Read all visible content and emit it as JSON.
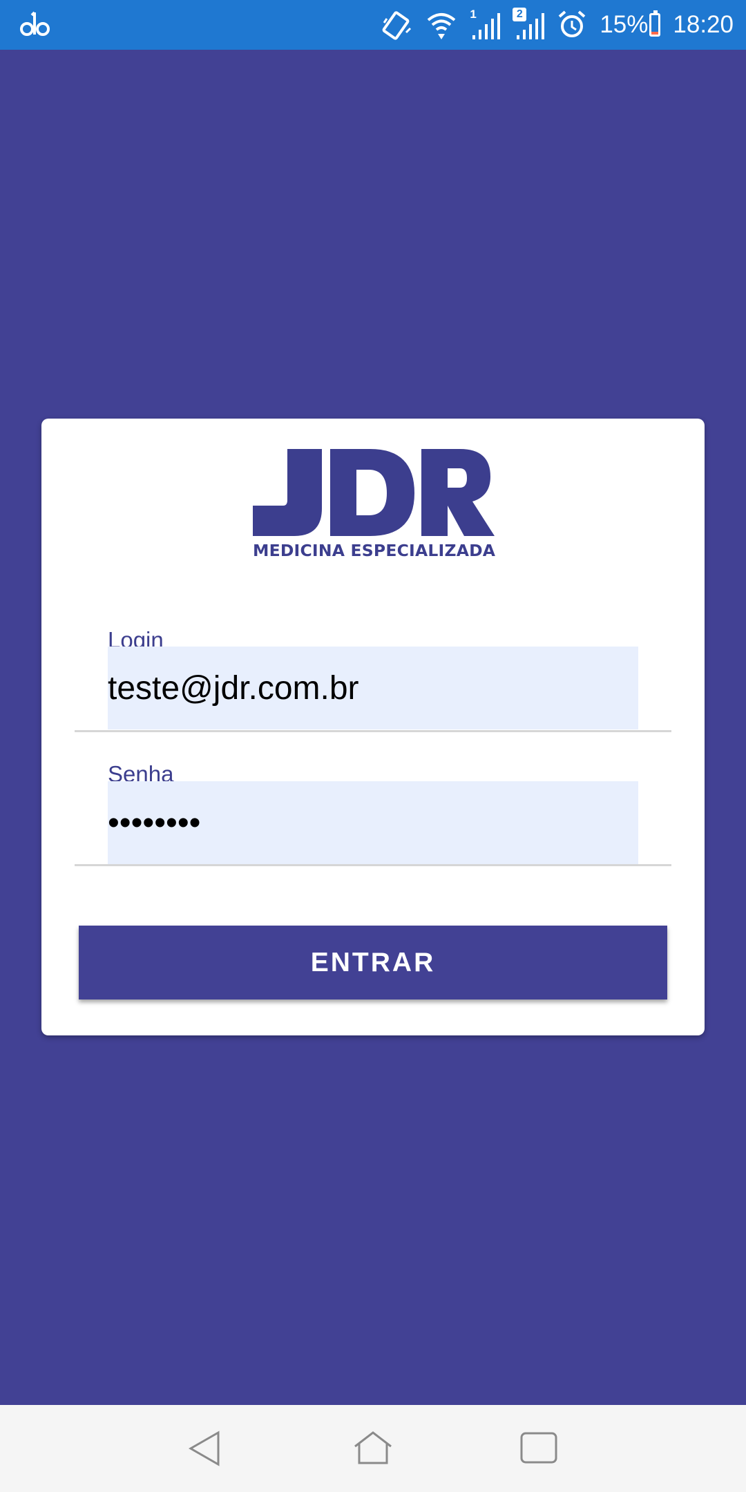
{
  "status_bar": {
    "left_icon": "app-notification-icon",
    "icons": [
      "vibrate-icon",
      "wifi-icon",
      "signal-sim1-icon",
      "signal-sim2-icon",
      "alarm-icon"
    ],
    "sim1_label": "1",
    "sim2_label": "2",
    "battery_percent": "15%",
    "battery_level": 0.15,
    "time": "18:20",
    "bar_color": "#1f78d1"
  },
  "logo": {
    "text": "JDR",
    "subtitle": "MEDICINA ESPECIALIZADA",
    "color": "#3c3e8e"
  },
  "form": {
    "login_label": "Login",
    "login_value": "teste@jdr.com.br",
    "password_label": "Senha",
    "password_value": "••••••••",
    "submit_label": "ENTRAR"
  },
  "colors": {
    "background": "#424194",
    "field_fill": "#e8effd",
    "button": "#424194"
  },
  "nav_bar": {
    "buttons": [
      "back-icon",
      "home-icon",
      "recents-icon"
    ]
  }
}
